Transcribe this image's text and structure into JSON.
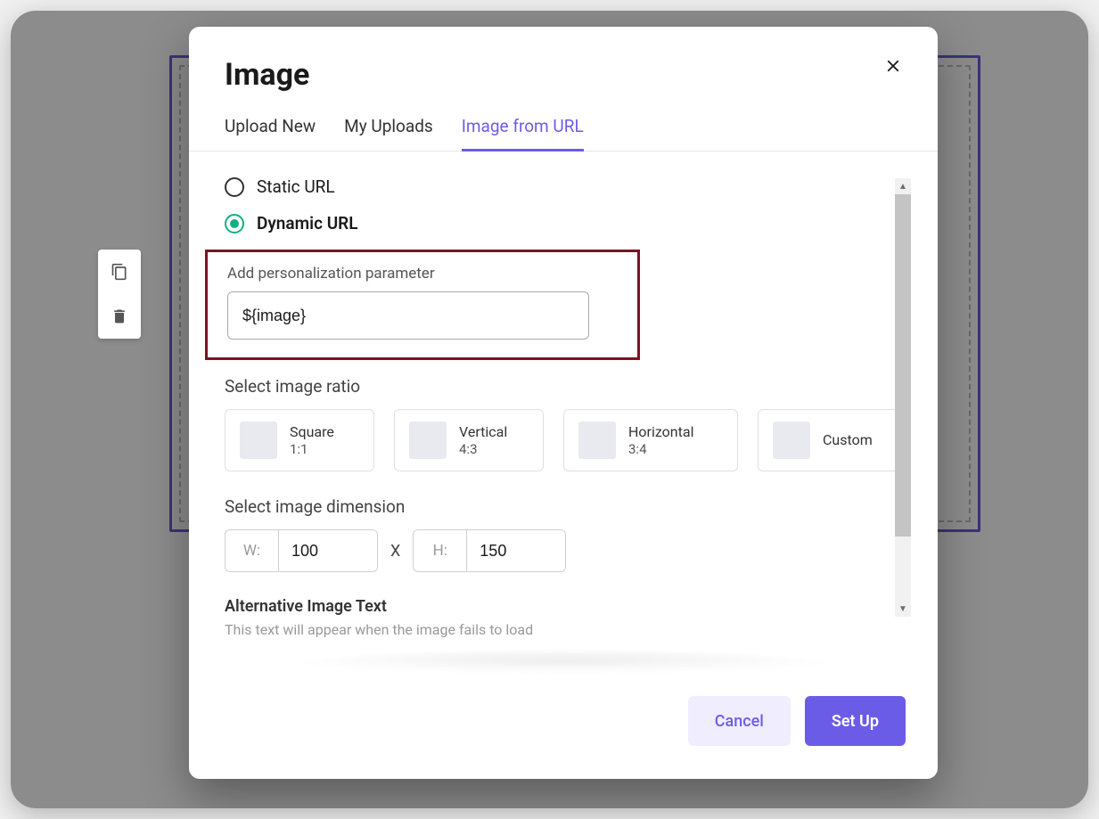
{
  "modal": {
    "title": "Image",
    "tabs": [
      {
        "label": "Upload New",
        "active": false
      },
      {
        "label": "My Uploads",
        "active": false
      },
      {
        "label": "Image from URL",
        "active": true
      }
    ],
    "url_type": {
      "static_label": "Static URL",
      "dynamic_label": "Dynamic URL",
      "selected": "dynamic"
    },
    "personalization": {
      "label": "Add personalization parameter",
      "value": "${image}"
    },
    "ratio": {
      "label": "Select image ratio",
      "options": [
        {
          "name": "Square",
          "sub": "1:1"
        },
        {
          "name": "Vertical",
          "sub": "4:3"
        },
        {
          "name": "Horizontal",
          "sub": "3:4"
        },
        {
          "name": "Custom",
          "sub": ""
        }
      ]
    },
    "dimension": {
      "label": "Select image dimension",
      "w_prefix": "W:",
      "w_value": "100",
      "separator": "X",
      "h_prefix": "H:",
      "h_value": "150"
    },
    "alt_text": {
      "title": "Alternative Image Text",
      "subtitle": "This text will appear when the image fails to load"
    },
    "footer": {
      "cancel": "Cancel",
      "submit": "Set Up"
    }
  }
}
